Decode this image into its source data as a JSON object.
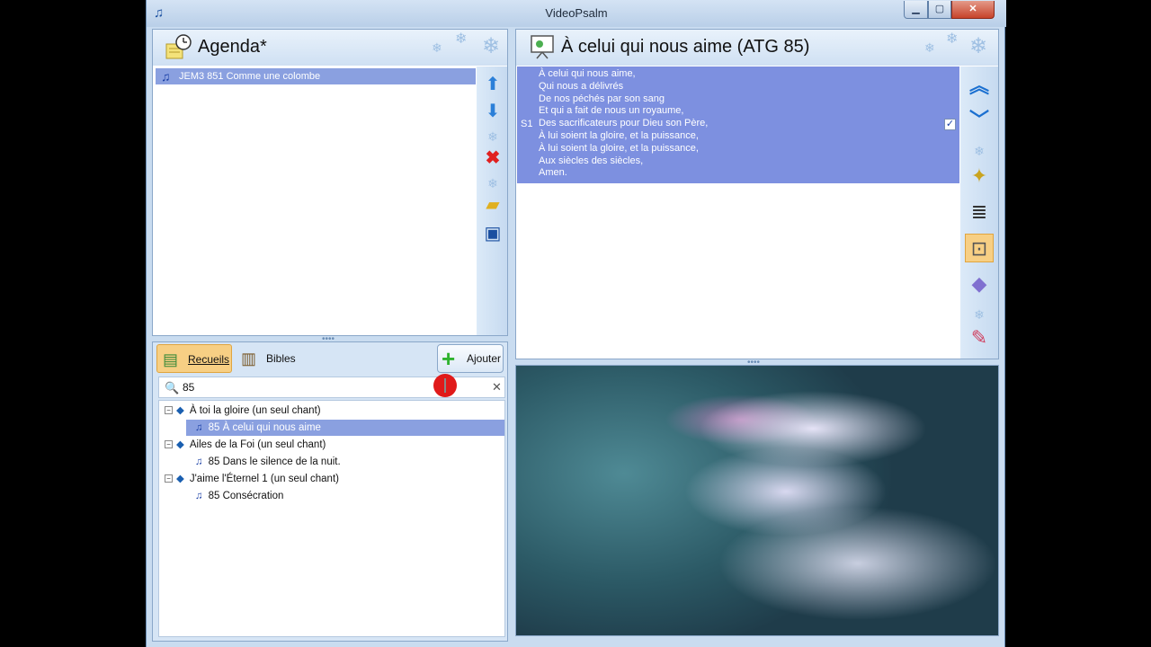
{
  "window": {
    "title": "VideoPsalm",
    "minimize": "▁",
    "maximize": "▢",
    "close": "✕"
  },
  "agenda": {
    "title": "Agenda*",
    "items": [
      {
        "label": "JEM3   851  Comme une colombe"
      }
    ]
  },
  "song": {
    "title": "À celui qui nous aime (ATG 85)",
    "verse_label": "S1",
    "verse_checked": "✓",
    "lines": [
      "À celui qui nous aime,",
      "Qui nous a délivrés",
      "De nos péchés par son sang",
      "Et qui a fait de nous un royaume,",
      "Des sacrificateurs pour Dieu son Père,",
      "À lui soient la gloire, et la puissance,",
      "À lui soient la gloire, et la puissance,",
      "Aux siècles des siècles,",
      "Amen."
    ]
  },
  "library": {
    "tabs": [
      {
        "label": "Recueils"
      },
      {
        "label": "Bibles"
      }
    ],
    "add_label": "Ajouter",
    "search_value": "85",
    "tree": [
      {
        "book": "À toi la gloire (un seul chant)",
        "song": "85  À celui qui nous aime"
      },
      {
        "book": "Ailes de la Foi (un seul chant)",
        "song": "85  Dans le silence de la nuit."
      },
      {
        "book": "J'aime l'Éternel 1 (un seul chant)",
        "song": "85  Consécration"
      }
    ]
  },
  "colors": {
    "accent": "#8aa0e0",
    "active_tool": "#f7cf84",
    "window": "#c9dcf0"
  }
}
